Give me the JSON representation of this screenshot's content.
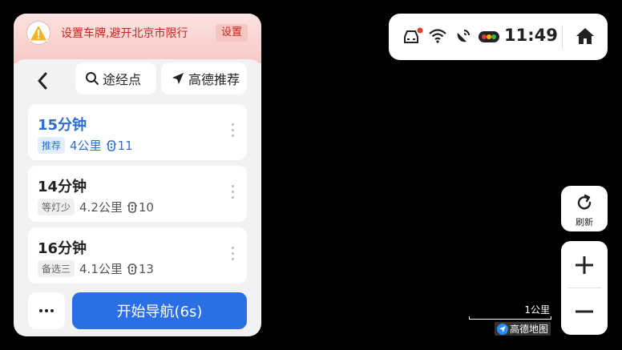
{
  "banner": {
    "text": "设置车牌,避开北京市限行",
    "button": "设置"
  },
  "toolbar": {
    "waypoint_label": "途经点",
    "recommend_label": "高德推荐"
  },
  "routes": [
    {
      "time": "15分钟",
      "tag": "推荐",
      "distance": "4公里",
      "lights": "11"
    },
    {
      "time": "14分钟",
      "tag": "等灯少",
      "distance": "4.2公里",
      "lights": "10"
    },
    {
      "time": "16分钟",
      "tag": "备选三",
      "distance": "4.1公里",
      "lights": "13"
    }
  ],
  "actions": {
    "start_label": "开始导航(6s)"
  },
  "status": {
    "time": "11:49"
  },
  "map": {
    "refresh_label": "刷新",
    "scale_label": "1公里",
    "brand": "高德地图"
  },
  "colors": {
    "accent": "#2a6fe6",
    "warning": "#c9251f",
    "active_route": "#2a6fd6"
  }
}
